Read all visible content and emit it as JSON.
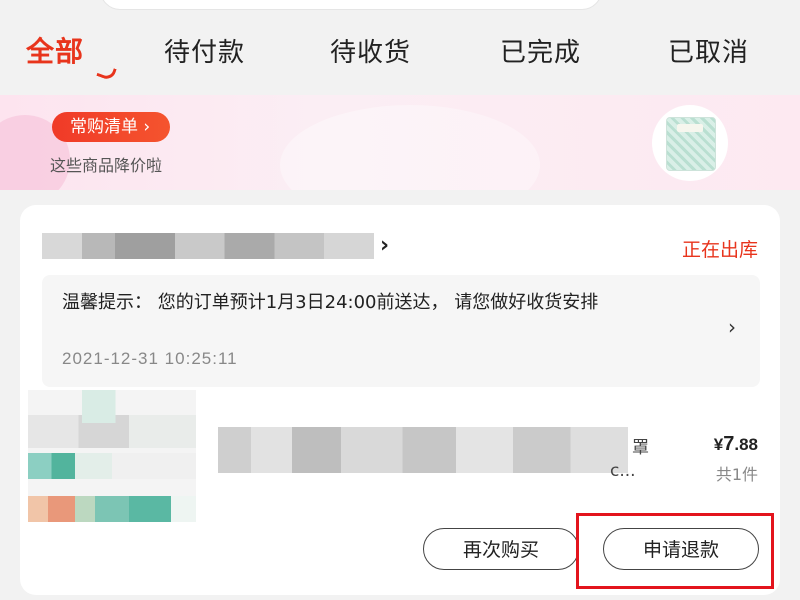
{
  "tabs": [
    {
      "label": "全部",
      "active": true
    },
    {
      "label": "待付款",
      "active": false
    },
    {
      "label": "待收货",
      "active": false
    },
    {
      "label": "已完成",
      "active": false
    },
    {
      "label": "已取消",
      "active": false
    }
  ],
  "banner": {
    "pill_label": "常购清单 ›",
    "subtitle": "这些商品降价啦"
  },
  "order": {
    "status": "正在出库",
    "tip": "温馨提示： 您的订单预计1月3日24:00前送达， 请您做好收货安排",
    "time": "2021-12-31 10:25:11",
    "title_tail_line1": "罩",
    "title_tail_line2": "c...",
    "price_symbol": "¥",
    "price_int": "7",
    "price_dec": ".88",
    "quantity": "共1件",
    "buttons": {
      "rebuy": "再次购买",
      "refund": "申请退款"
    }
  },
  "colors": {
    "accent": "#e8341c",
    "highlight": "#e3141d"
  }
}
